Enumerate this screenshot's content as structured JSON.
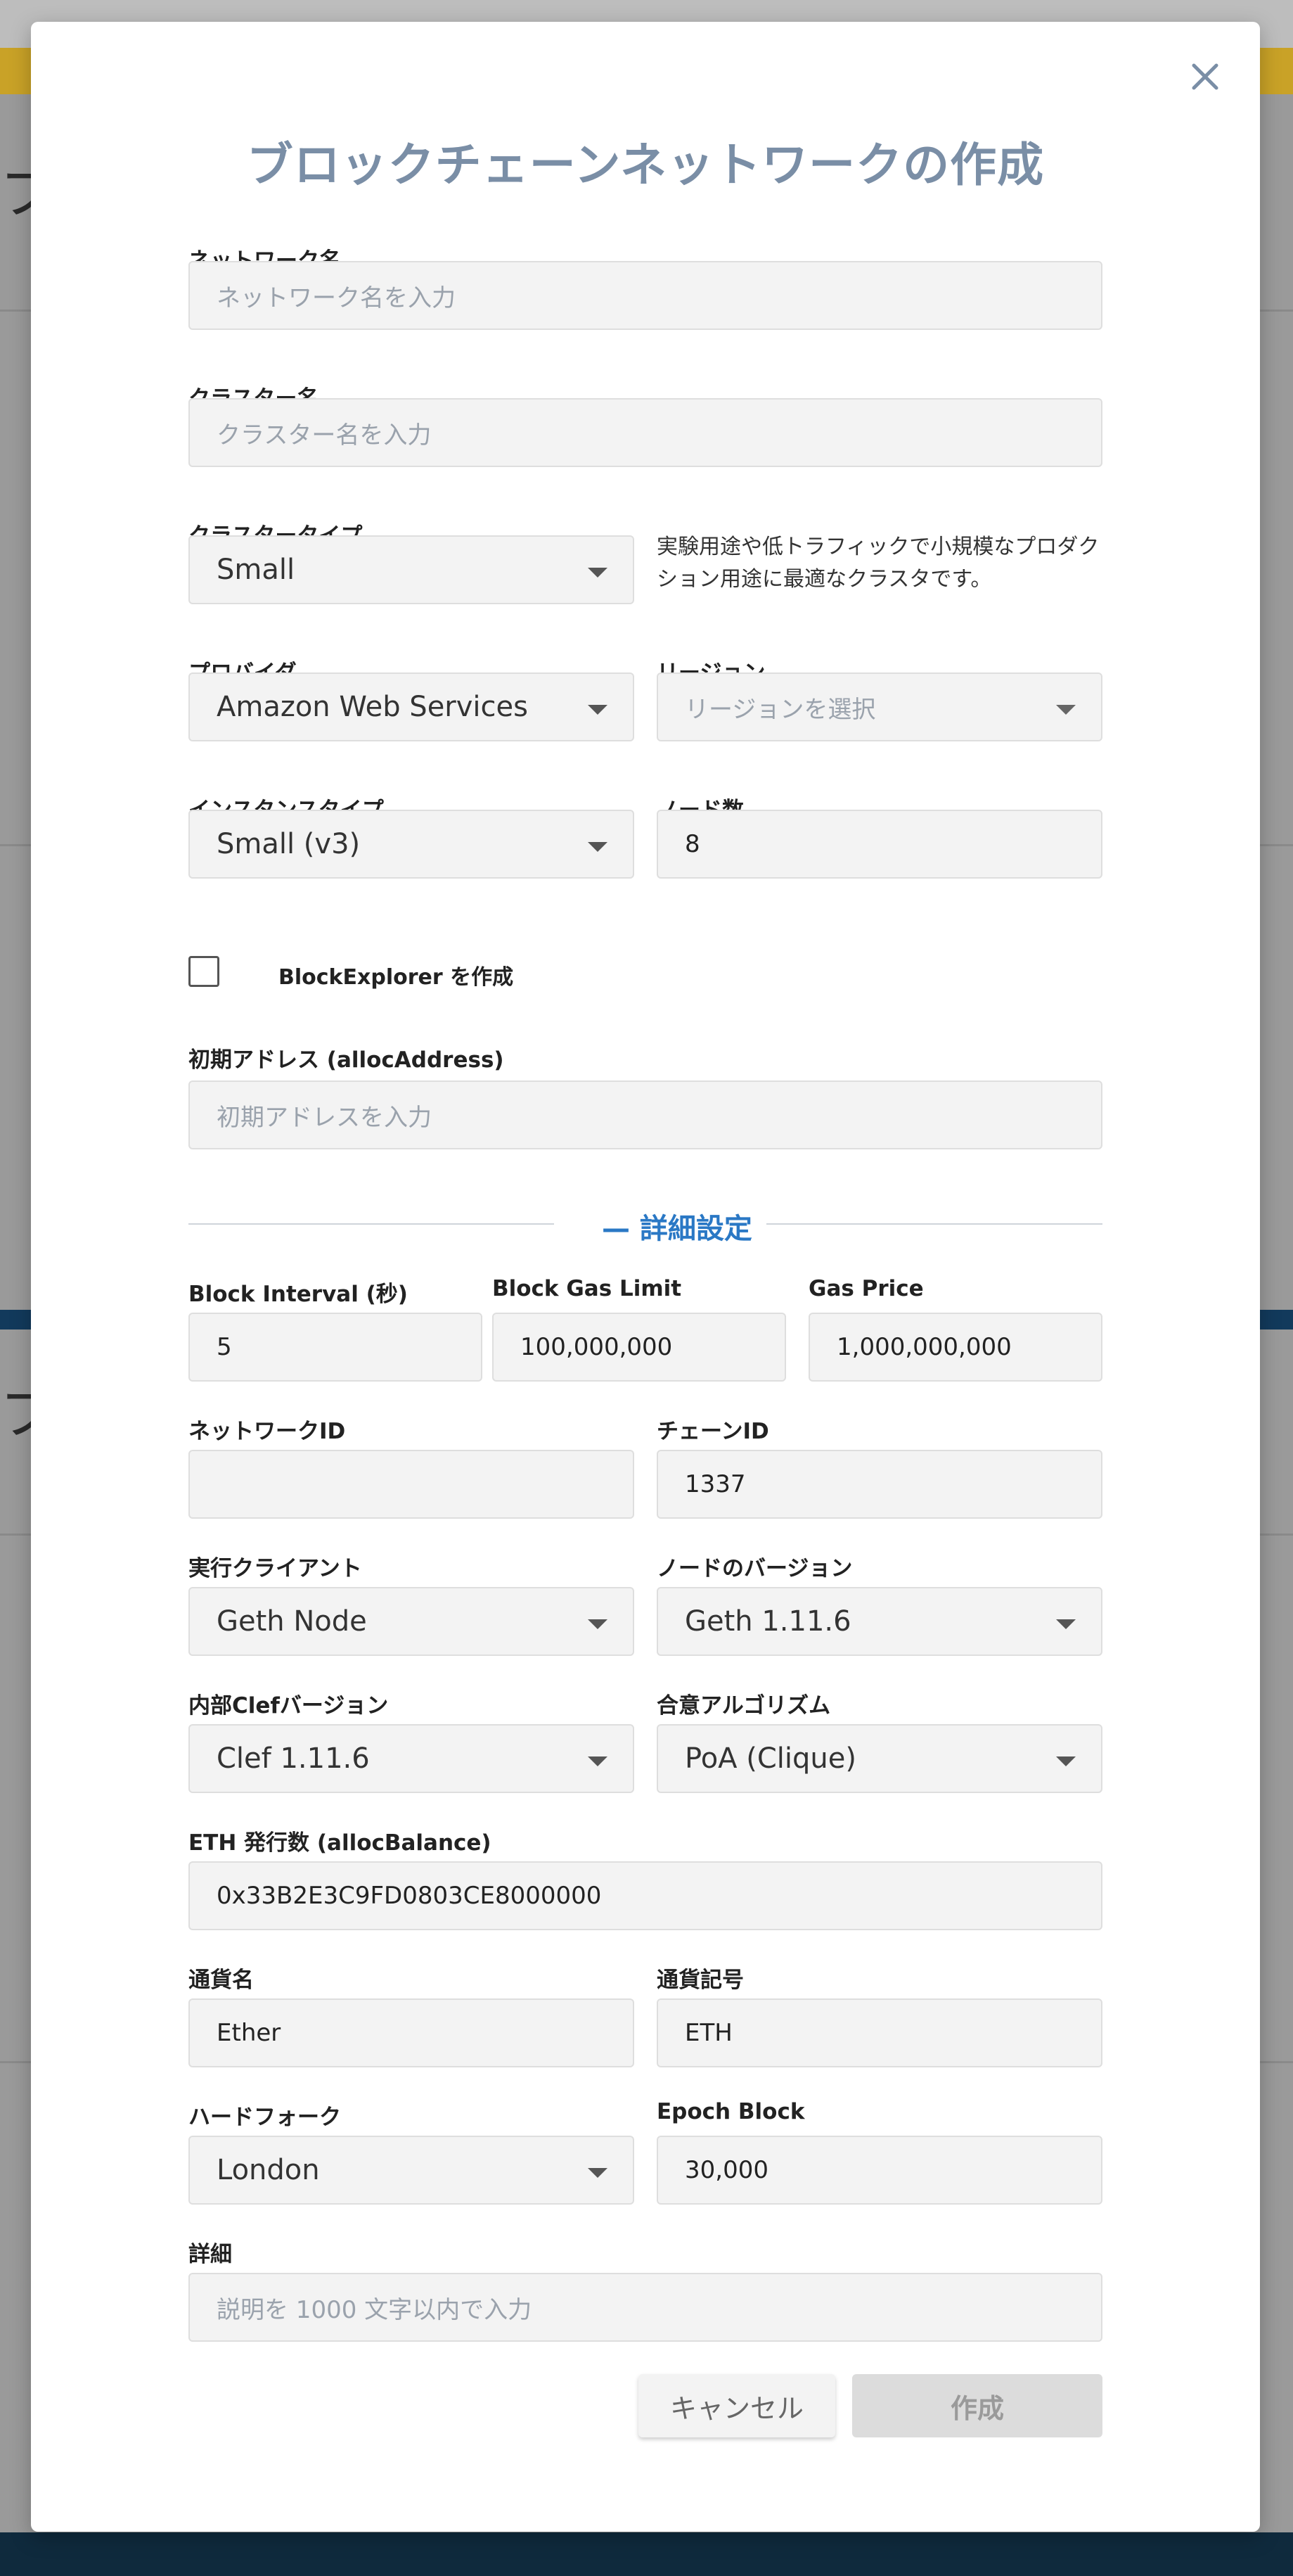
{
  "modal": {
    "title": "ブロックチェーンネットワークの作成",
    "close_icon": "close-icon"
  },
  "form": {
    "network_name": {
      "label": "ネットワーク名",
      "placeholder": "ネットワーク名を入力"
    },
    "cluster_name": {
      "label": "クラスター名",
      "placeholder": "クラスター名を入力"
    },
    "cluster_type": {
      "label": "クラスタータイプ",
      "value": "Small",
      "note": "実験用途や低トラフィックで小規模なプロダクション用途に最適なクラスタです。"
    },
    "provider": {
      "label": "プロバイダ",
      "value": "Amazon Web Services"
    },
    "region": {
      "label": "リージョン",
      "placeholder": "リージョンを選択"
    },
    "instance_type": {
      "label": "インスタンスタイプ",
      "value": "Small (v3)"
    },
    "node_count": {
      "label": "ノード数",
      "value": "8"
    },
    "block_explorer": {
      "label": "BlockExplorer を作成",
      "checked": false
    },
    "alloc_address": {
      "label": "初期アドレス (allocAddress)",
      "placeholder": "初期アドレスを入力"
    },
    "advanced_divider": "— 詳細設定",
    "block_interval": {
      "label": "Block Interval (秒)",
      "value": "5"
    },
    "block_gas_limit": {
      "label": "Block Gas Limit",
      "value": "100,000,000"
    },
    "gas_price": {
      "label": "Gas Price",
      "value": "1,000,000,000"
    },
    "network_id": {
      "label": "ネットワークID",
      "value": ""
    },
    "chain_id": {
      "label": "チェーンID",
      "value": "1337"
    },
    "exec_client": {
      "label": "実行クライアント",
      "value": "Geth Node"
    },
    "node_version": {
      "label": "ノードのバージョン",
      "value": "Geth 1.11.6"
    },
    "clef_version": {
      "label": "内部Clefバージョン",
      "value": "Clef 1.11.6"
    },
    "consensus": {
      "label": "合意アルゴリズム",
      "value": "PoA (Clique)"
    },
    "alloc_balance": {
      "label": "ETH 発行数 (allocBalance)",
      "value": "0x33B2E3C9FD0803CE8000000"
    },
    "currency_name": {
      "label": "通貨名",
      "value": "Ether"
    },
    "currency_symbol": {
      "label": "通貨記号",
      "value": "ETH"
    },
    "hard_fork": {
      "label": "ハードフォーク",
      "value": "London"
    },
    "epoch_block": {
      "label": "Epoch Block",
      "value": "30,000"
    },
    "details": {
      "label": "詳細",
      "placeholder": "説明を 1000 文字以内で入力"
    }
  },
  "buttons": {
    "cancel": "キャンセル",
    "create": "作成"
  },
  "background": {
    "glyph": "ブ"
  },
  "colors": {
    "title": "#7a8ea6",
    "accent": "#2a78c5",
    "input_bg": "#f3f3f3"
  }
}
